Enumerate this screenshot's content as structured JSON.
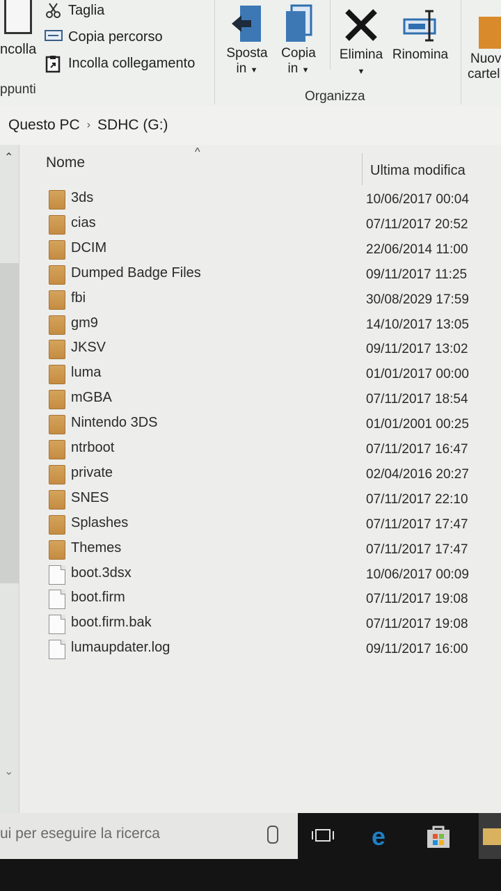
{
  "ribbon": {
    "clipboard": {
      "paste_label": "ncolla",
      "cut_label": "Taglia",
      "copy_path_label": "Copia percorso",
      "paste_shortcut_label": "Incolla collegamento",
      "group_label": "ppunti"
    },
    "organize": {
      "move_to_line1": "Sposta",
      "move_to_line2": "in",
      "copy_to_line1": "Copia",
      "copy_to_line2": "in",
      "delete_label": "Elimina",
      "rename_label": "Rinomina",
      "group_label": "Organizza"
    },
    "new": {
      "new_folder_line1": "Nuov",
      "new_folder_line2": "cartel"
    }
  },
  "address": {
    "root": "Questo PC",
    "drive": "SDHC (G:)"
  },
  "columns": {
    "name": "Nome",
    "modified": "Ultima modifica"
  },
  "files": [
    {
      "name": "3ds",
      "date": "10/06/2017 00:04",
      "type": "folder"
    },
    {
      "name": "cias",
      "date": "07/11/2017 20:52",
      "type": "folder"
    },
    {
      "name": "DCIM",
      "date": "22/06/2014 11:00",
      "type": "folder"
    },
    {
      "name": "Dumped Badge Files",
      "date": "09/11/2017 11:25",
      "type": "folder"
    },
    {
      "name": "fbi",
      "date": "30/08/2029 17:59",
      "type": "folder"
    },
    {
      "name": "gm9",
      "date": "14/10/2017 13:05",
      "type": "folder"
    },
    {
      "name": "JKSV",
      "date": "09/11/2017 13:02",
      "type": "folder"
    },
    {
      "name": "luma",
      "date": "01/01/2017 00:00",
      "type": "folder"
    },
    {
      "name": "mGBA",
      "date": "07/11/2017 18:54",
      "type": "folder"
    },
    {
      "name": "Nintendo 3DS",
      "date": "01/01/2001 00:25",
      "type": "folder"
    },
    {
      "name": "ntrboot",
      "date": "07/11/2017 16:47",
      "type": "folder"
    },
    {
      "name": "private",
      "date": "02/04/2016 20:27",
      "type": "folder"
    },
    {
      "name": "SNES",
      "date": "07/11/2017 22:10",
      "type": "folder"
    },
    {
      "name": "Splashes",
      "date": "07/11/2017 17:47",
      "type": "folder"
    },
    {
      "name": "Themes",
      "date": "07/11/2017 17:47",
      "type": "folder"
    },
    {
      "name": "boot.3dsx",
      "date": "10/06/2017 00:09",
      "type": "file"
    },
    {
      "name": "boot.firm",
      "date": "07/11/2017 19:08",
      "type": "file"
    },
    {
      "name": "boot.firm.bak",
      "date": "07/11/2017 19:08",
      "type": "file"
    },
    {
      "name": "lumaupdater.log",
      "date": "09/11/2017 16:00",
      "type": "file"
    }
  ],
  "taskbar": {
    "search_placeholder": "ui per eseguire la ricerca",
    "icons": [
      "mic-icon",
      "task-view-icon",
      "edge-icon",
      "store-icon",
      "file-explorer-icon"
    ]
  },
  "colors": {
    "folder": "#c99548",
    "edge": "#1e7fc4",
    "ribbon_icon": "#2f6fb0"
  }
}
